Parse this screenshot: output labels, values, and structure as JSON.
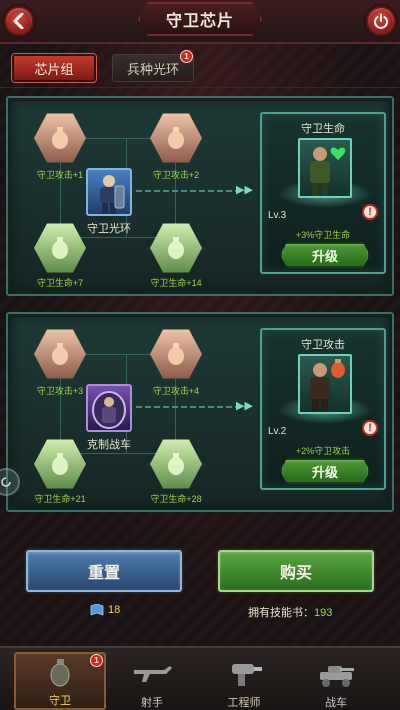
{
  "header": {
    "title": "守卫芯片"
  },
  "tabs": [
    {
      "label": "芯片组",
      "active": true
    },
    {
      "label": "兵种光环",
      "active": false,
      "badge": "1"
    }
  ],
  "panels": [
    {
      "center_label": "守卫光环",
      "chips": [
        {
          "label": "守卫攻击+1",
          "type": "attack"
        },
        {
          "label": "守卫攻击+2",
          "type": "attack"
        },
        {
          "label": "守卫生命+7",
          "type": "health"
        },
        {
          "label": "守卫生命+14",
          "type": "health"
        }
      ],
      "info": {
        "title": "守卫生命",
        "level": "Lv.3",
        "bonus": "+3%守卫生命",
        "upgrade_label": "升级",
        "warn": "!"
      }
    },
    {
      "center_label": "克制战车",
      "chips": [
        {
          "label": "守卫攻击+3",
          "type": "attack"
        },
        {
          "label": "守卫攻击+4",
          "type": "attack"
        },
        {
          "label": "守卫生命+21",
          "type": "health"
        },
        {
          "label": "守卫生命+28",
          "type": "health"
        }
      ],
      "info": {
        "title": "守卫攻击",
        "level": "Lv.2",
        "bonus": "+2%守卫攻击",
        "upgrade_label": "升级",
        "warn": "!"
      }
    }
  ],
  "actions": {
    "reset_label": "重置",
    "buy_label": "购买"
  },
  "resources": {
    "gems": "18",
    "skillbook_label": "拥有技能书：",
    "skillbook_count": "193"
  },
  "nav": [
    {
      "label": "守卫",
      "active": true,
      "badge": "1",
      "icon": "grenade-icon"
    },
    {
      "label": "射手",
      "active": false,
      "icon": "rifle-icon"
    },
    {
      "label": "工程师",
      "active": false,
      "icon": "drill-gun-icon"
    },
    {
      "label": "战车",
      "active": false,
      "icon": "tank-icon"
    }
  ],
  "colors": {
    "accent_red": "#c43a2e",
    "accent_green": "#4f9a36",
    "panel_teal": "#3b6e68",
    "bonus_green": "#9fd24a"
  }
}
